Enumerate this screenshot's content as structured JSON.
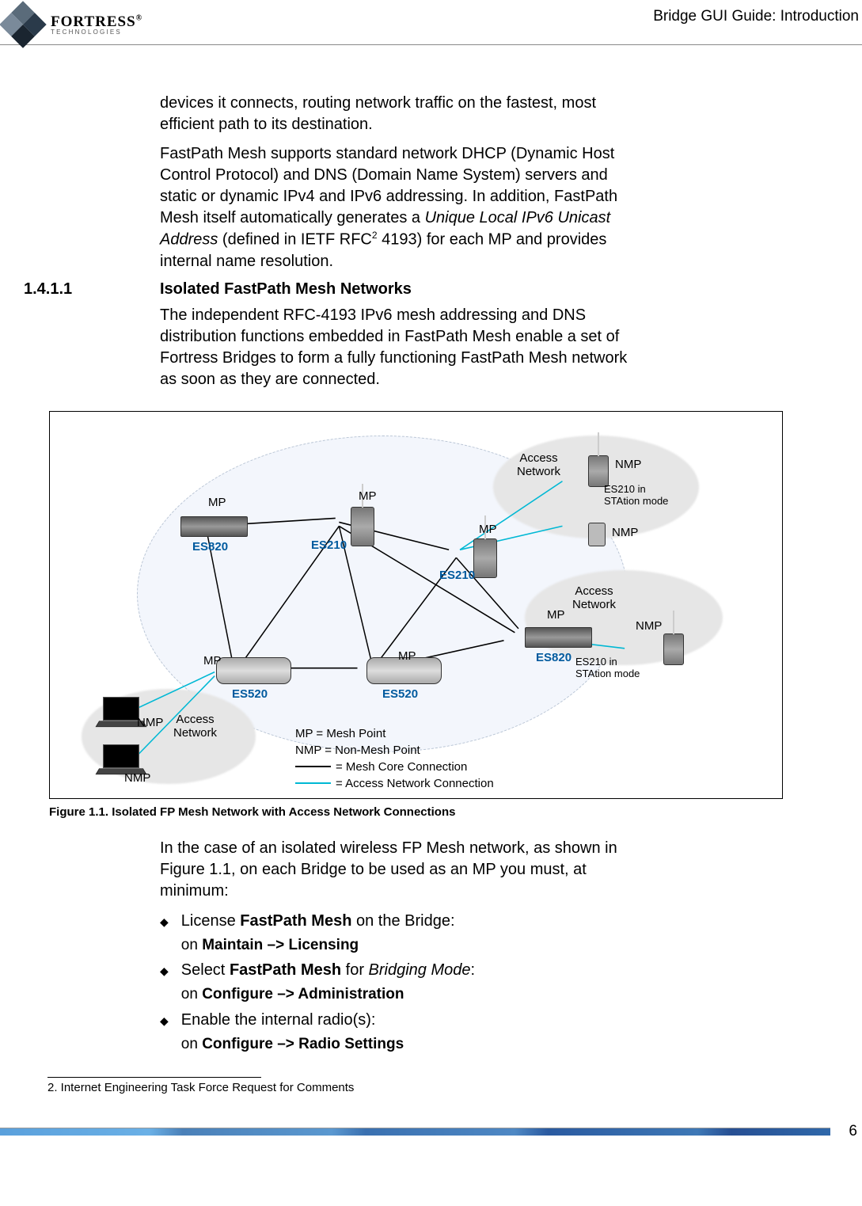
{
  "header": {
    "brand_main": "FORTRESS",
    "brand_reg": "®",
    "brand_sub": "TECHNOLOGIES",
    "doc_title": "Bridge GUI Guide: Introduction"
  },
  "paragraph1": "devices it connects, routing network traffic on the fastest, most efficient path to its destination.",
  "paragraph2a": "FastPath Mesh supports standard network DHCP (Dynamic Host Control Protocol) and DNS (Domain Name System) servers and static or dynamic IPv4 and IPv6 addressing. In addition, FastPath Mesh itself automatically generates a ",
  "paragraph2_italic": "Unique Local IPv6 Unicast Address",
  "paragraph2b": " (defined in IETF RFC",
  "paragraph2_sup": "2",
  "paragraph2c": " 4193) for each MP and provides internal name resolution.",
  "section": {
    "num": "1.4.1.1",
    "title": "Isolated FastPath Mesh Networks"
  },
  "paragraph3": "The independent RFC-4193 IPv6 mesh addressing and DNS distribution functions embedded in FastPath Mesh enable a set of Fortress Bridges to form a fully functioning FastPath Mesh network as soon as they are connected.",
  "figure": {
    "caption": "Figure 1.1.   Isolated FP Mesh Network with Access Network Connections",
    "labels": {
      "mp": "MP",
      "nmp": "NMP",
      "access_network": "Access\nNetwork",
      "es820": "ES820",
      "es210": "ES210",
      "es520": "ES520",
      "es210_sta_a": "ES210",
      "es210_sta_b": " in\nSTAtion mode"
    },
    "legend": {
      "l1": "MP = Mesh Point",
      "l2": "NMP = Non-Mesh Point",
      "l3": "= Mesh Core Connection",
      "l4": "= Access Network Connection"
    }
  },
  "paragraph4": "In the case of an isolated wireless FP Mesh network, as shown in Figure 1.1, on each Bridge to be used as an MP you must, at minimum:",
  "bullets": [
    {
      "line1a": "License ",
      "line1_bold1": "FastPath Mesh",
      "line1b": " on the Bridge:",
      "sub_prefix": "on ",
      "sub_bold": "Maintain –> Licensing"
    },
    {
      "line1a": "Select ",
      "line1_bold1": "FastPath Mesh",
      "line1b": " for ",
      "line1_italic": "Bridging Mode",
      "line1c": ":",
      "sub_prefix": "on ",
      "sub_bold": "Configure –> Administration"
    },
    {
      "line1a": "Enable the internal radio(s):",
      "sub_prefix": "on ",
      "sub_bold": "Configure –> Radio Settings"
    }
  ],
  "footnote": "2. Internet Engineering Task Force Request for Comments",
  "page_number": "6"
}
